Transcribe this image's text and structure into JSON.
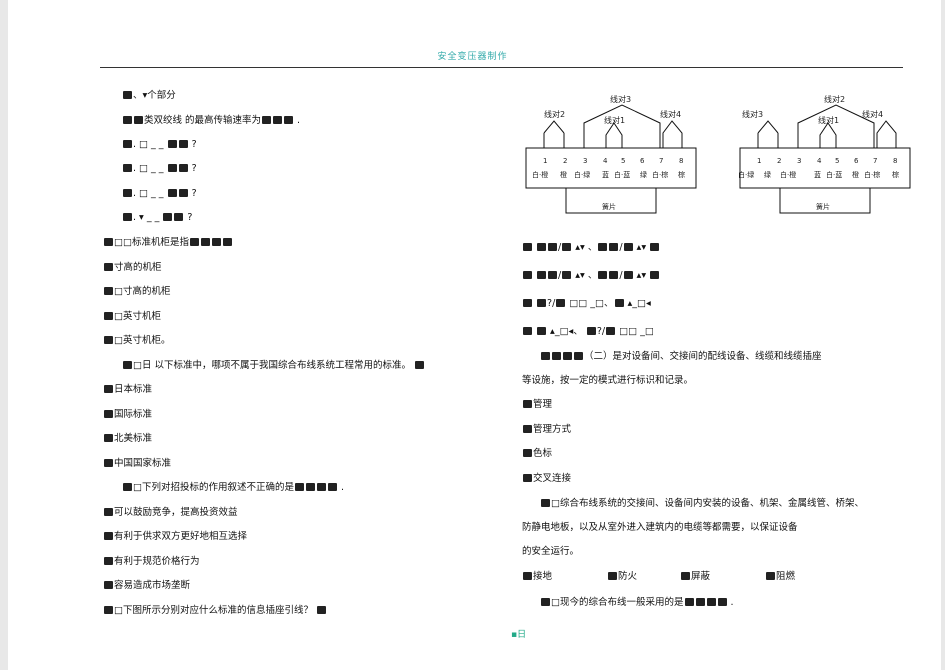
{
  "header": {
    "title": "安全变压器制作"
  },
  "left_column": {
    "lines": [
      "、▾个部分",
      "类双绞线 的最高传输速率为",
      "",
      "",
      "",
      "",
      "标准机柜是指",
      "寸高的机柜",
      "寸高的机柜",
      "英寸机柜",
      "英寸机柜。",
      "以下标准中，哪项不属于我国综合布线系统工程常用的标准。",
      "日本标准",
      "国际标准",
      "北美标准",
      "中国国家标准",
      "下列对招投标的作用叙述不正确的是",
      "可以鼓励竞争，提高投资效益",
      "有利于供求双方更好地相互选择",
      "有利于规范价格行为",
      "容易造成市场垄断",
      "下图所示分别对应什么标准的信息插座引线？"
    ]
  },
  "right_column": {
    "lines": [
      "、",
      "、",
      "、",
      "、",
      "（二）是对设备间、交接间的配线设备、线缆和线缆插座",
      "等设施，按一定的模式进行标识和记录。",
      "管理",
      "管理方式",
      "色标",
      "交叉连接",
      "综合布线系统的交接间、设备间内安装的设备、机架、金属线管、桥架、",
      "防静电地板，以及从室外进入建筑内的电缆等都需要，以保证设备",
      "的安全运行。",
      "接地",
      "防火",
      "屏蔽",
      "阻燃",
      "现今的综合布线一般采用的是"
    ]
  },
  "diagram_left": {
    "pair_top": "线对3",
    "pairs": [
      "线对2",
      "线对1",
      "线对4"
    ],
    "pins": [
      "1",
      "2",
      "3",
      "4",
      "5",
      "6",
      "7",
      "8"
    ],
    "colors": [
      "白·橙",
      "橙",
      "白·绿",
      "蓝",
      "白·蓝",
      "绿",
      "白·棕",
      "棕"
    ],
    "label": "簧片"
  },
  "diagram_right": {
    "pair_top": "线对2",
    "pairs": [
      "线对3",
      "线对1",
      "线对4"
    ],
    "pins": [
      "1",
      "2",
      "3",
      "4",
      "5",
      "6",
      "7",
      "8"
    ],
    "colors": [
      "白·绿",
      "绿",
      "白·橙",
      "蓝",
      "白·蓝",
      "橙",
      "白·棕",
      "棕"
    ],
    "label": "簧片"
  },
  "footer": {
    "page": "▪日"
  }
}
